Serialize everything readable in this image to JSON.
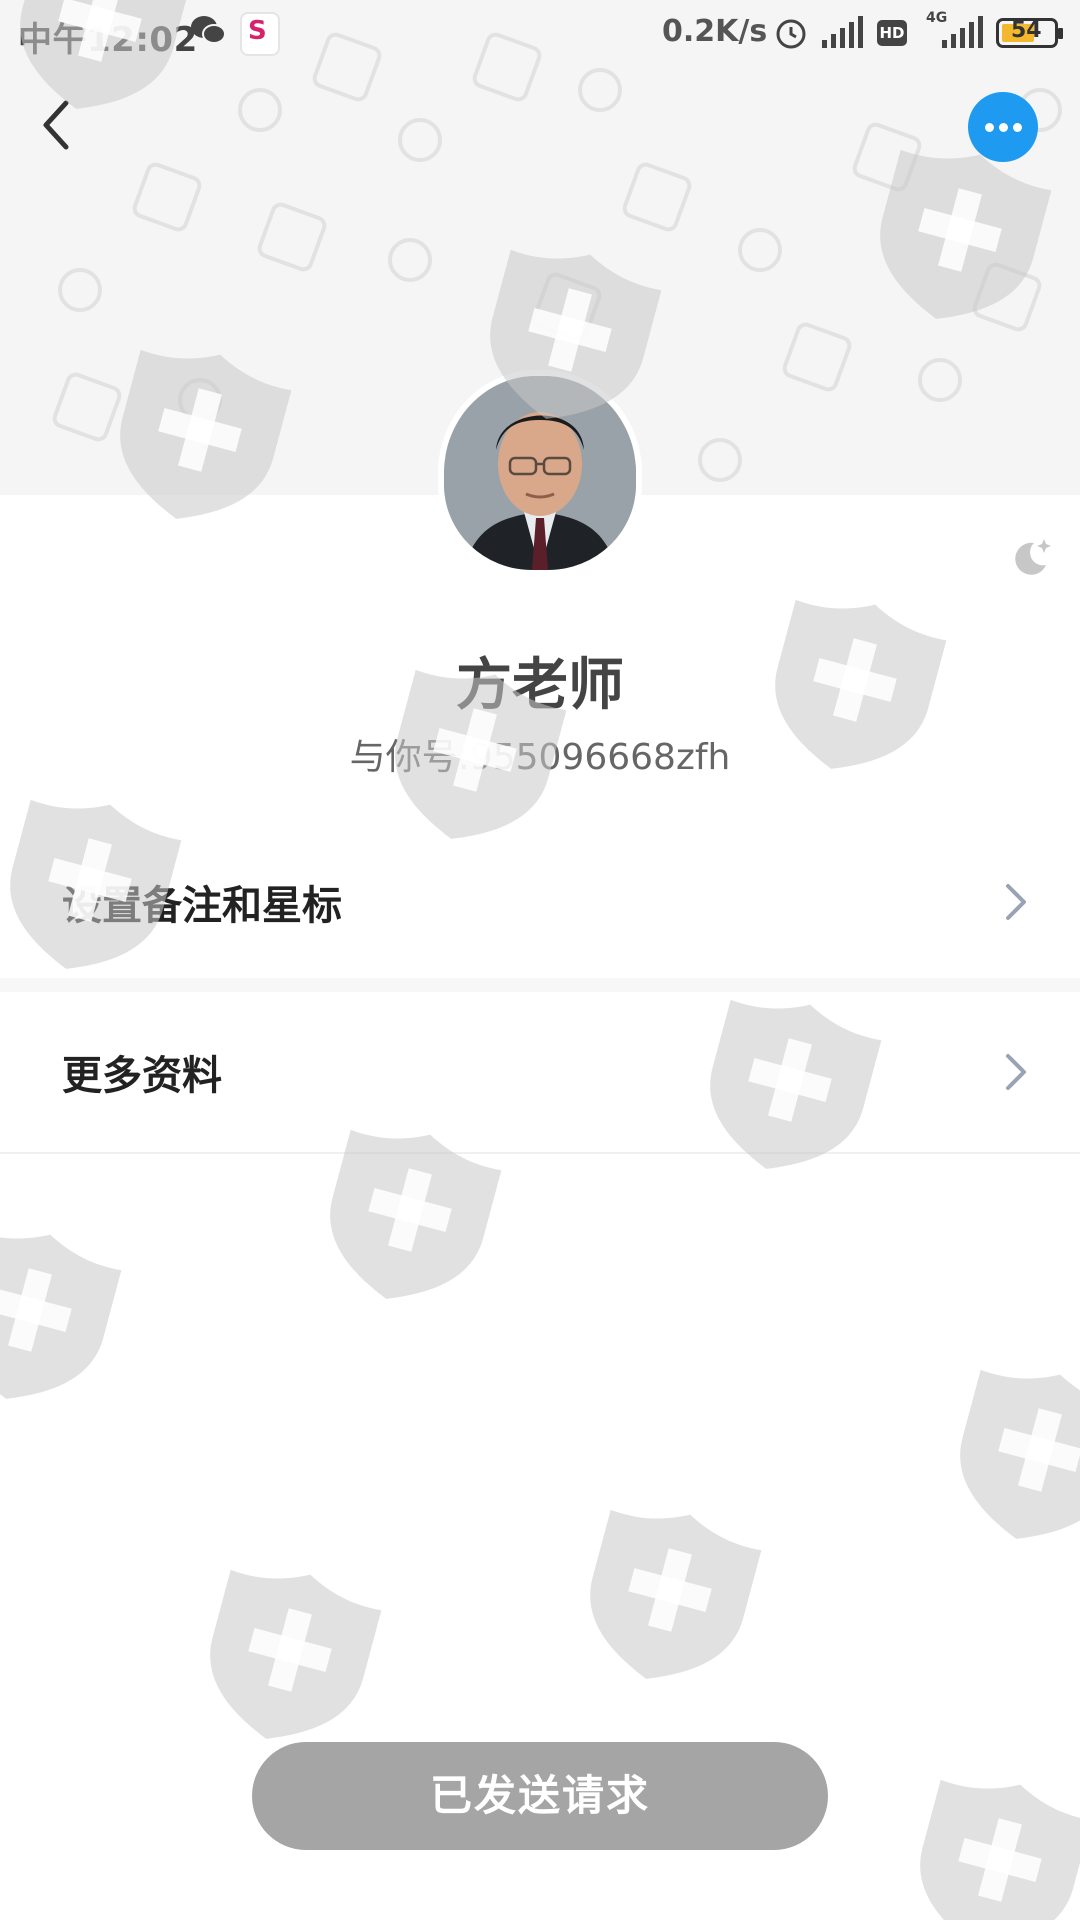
{
  "status_bar": {
    "time": "中午12:02",
    "net_speed": "0.2K/s",
    "network_type": "4G",
    "hd_label": "HD",
    "battery": "54",
    "icons": [
      "wechat-icon",
      "app-icon",
      "alarm-icon",
      "signal-icon",
      "hd-icon",
      "signal-4g-icon",
      "battery-icon"
    ]
  },
  "nav": {
    "back_icon": "chevron-left-icon",
    "more_icon": "more-dots-icon"
  },
  "profile": {
    "name": "方老师",
    "account_line": "与你号:955096668zfh",
    "night_mode_icon": "moon-icon"
  },
  "menu": {
    "items": [
      {
        "label": "设置备注和星标"
      },
      {
        "label": "更多资料"
      }
    ]
  },
  "action": {
    "button_label": "已发送请求"
  },
  "colors": {
    "accent": "#1e9bf0",
    "button_gray": "#a5a5a5",
    "header_bg": "#f5f5f5"
  }
}
